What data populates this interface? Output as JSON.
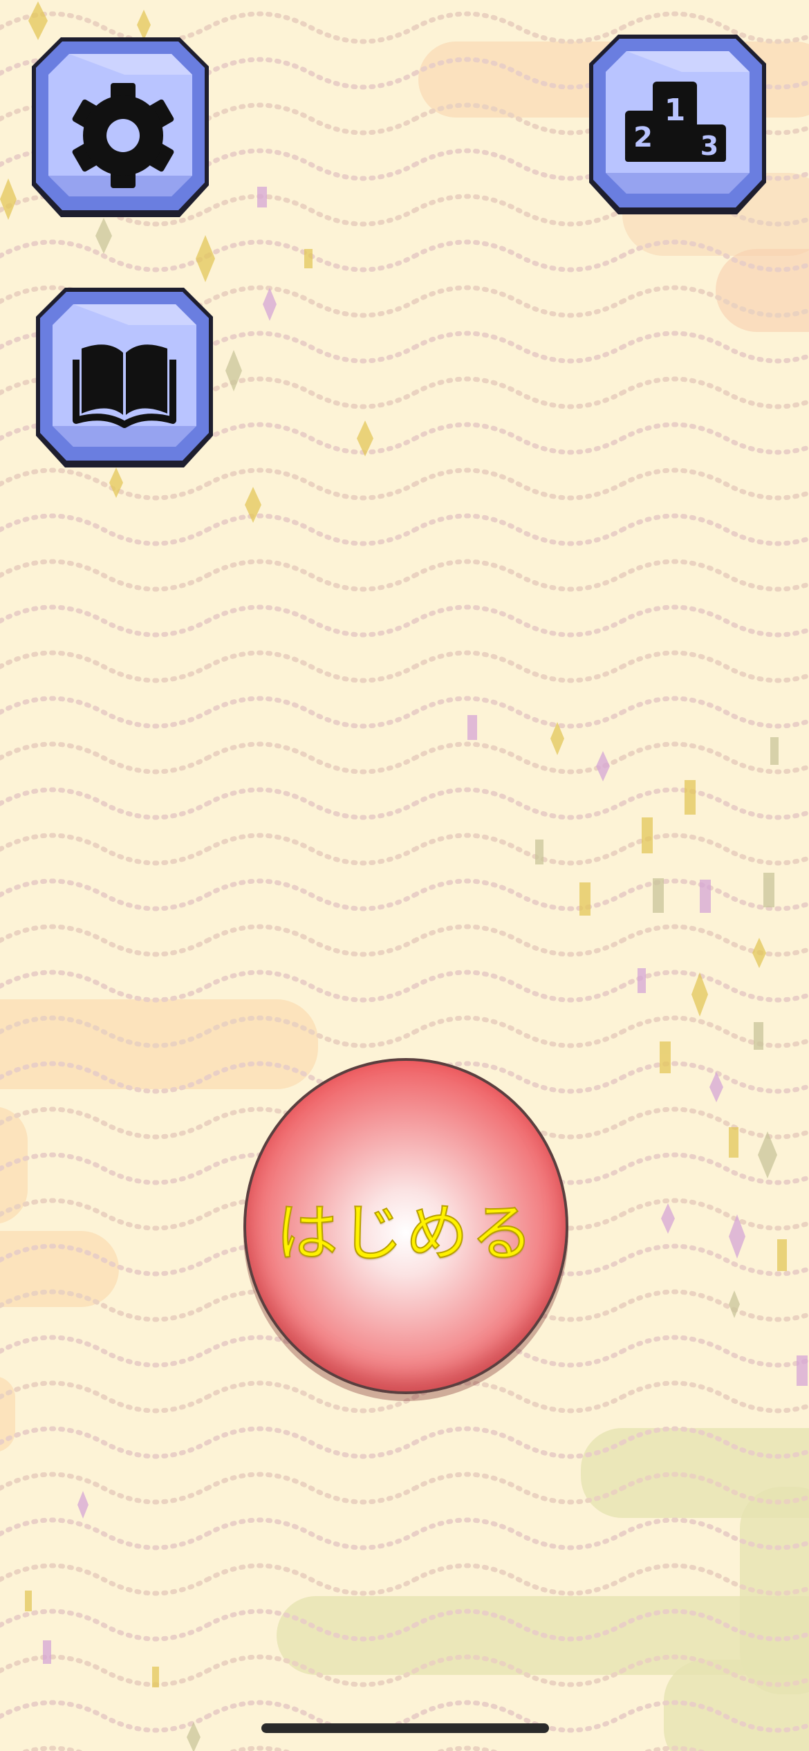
{
  "screen": {
    "name": "title-screen",
    "background_color": "#fdf3d6"
  },
  "buttons": {
    "settings": {
      "icon": "gear-icon"
    },
    "guide": {
      "icon": "open-book-icon"
    },
    "leaderboard": {
      "icon": "podium-icon",
      "ranks": [
        "1",
        "2",
        "3"
      ]
    },
    "start": {
      "label": "はじめる",
      "color": "#e8353b",
      "label_color": "#fff200"
    }
  },
  "colors": {
    "tile_face": "#b9c4ff",
    "tile_bevel": "#6a7ee0",
    "tile_outline": "#1e1e2e"
  }
}
